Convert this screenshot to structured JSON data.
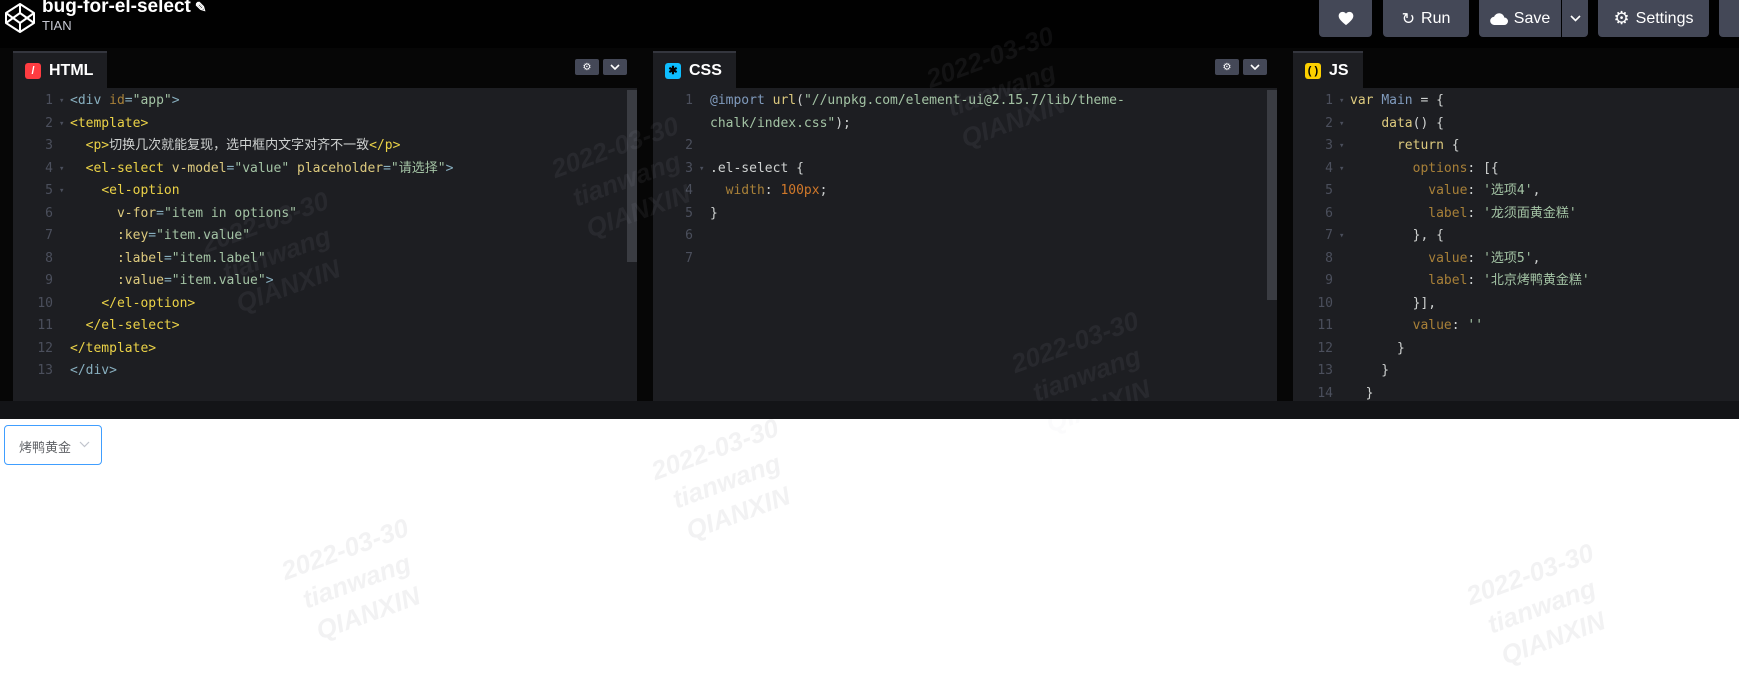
{
  "header": {
    "title": "bug-for-el-select",
    "author": "TIAN",
    "run_label": "Run",
    "save_label": "Save",
    "settings_label": "Settings"
  },
  "panels": {
    "html": {
      "label": "HTML",
      "lines": [
        {
          "n": "1",
          "f": "▾",
          "segs": [
            [
              "tag",
              "<div "
            ],
            [
              "at",
              "id"
            ],
            [
              "tag",
              "="
            ],
            [
              "st",
              "\"app\""
            ],
            [
              "tag",
              ">"
            ]
          ]
        },
        {
          "n": "2",
          "f": "▾",
          "segs": [
            [
              "tg",
              "<template>"
            ]
          ]
        },
        {
          "n": "3",
          "f": "",
          "segs": [
            [
              "plain",
              "  "
            ],
            [
              "tg",
              "<p>"
            ],
            [
              "plain",
              "切换几次就能复现，选中框内文字对齐不一致"
            ],
            [
              "tg",
              "</p>"
            ]
          ]
        },
        {
          "n": "4",
          "f": "▾",
          "segs": [
            [
              "plain",
              "  "
            ],
            [
              "tg",
              "<el-select "
            ],
            [
              "atr",
              "v-model"
            ],
            [
              "tag",
              "="
            ],
            [
              "st",
              "\"value\" "
            ],
            [
              "atr",
              "placeholder"
            ],
            [
              "tag",
              "="
            ],
            [
              "st",
              "\"请选择\""
            ],
            [
              "tag",
              ">"
            ]
          ]
        },
        {
          "n": "5",
          "f": "▾",
          "segs": [
            [
              "plain",
              "    "
            ],
            [
              "tg",
              "<el-option"
            ]
          ]
        },
        {
          "n": "6",
          "f": "",
          "segs": [
            [
              "plain",
              "      "
            ],
            [
              "atr",
              "v-for"
            ],
            [
              "tag",
              "="
            ],
            [
              "st",
              "\"item in options\""
            ]
          ]
        },
        {
          "n": "7",
          "f": "",
          "segs": [
            [
              "plain",
              "      "
            ],
            [
              "atr",
              ":key"
            ],
            [
              "tag",
              "="
            ],
            [
              "st",
              "\"item.value\""
            ]
          ]
        },
        {
          "n": "8",
          "f": "",
          "segs": [
            [
              "plain",
              "      "
            ],
            [
              "atr",
              ":label"
            ],
            [
              "tag",
              "="
            ],
            [
              "st",
              "\"item.label\""
            ]
          ]
        },
        {
          "n": "9",
          "f": "",
          "segs": [
            [
              "plain",
              "      "
            ],
            [
              "atr",
              ":value"
            ],
            [
              "tag",
              "="
            ],
            [
              "st",
              "\"item.value\""
            ],
            [
              "tag",
              ">"
            ]
          ]
        },
        {
          "n": "10",
          "f": "",
          "segs": [
            [
              "plain",
              "    "
            ],
            [
              "tg",
              "</el-option>"
            ]
          ]
        },
        {
          "n": "11",
          "f": "",
          "segs": [
            [
              "plain",
              "  "
            ],
            [
              "tg",
              "</el-select>"
            ]
          ]
        },
        {
          "n": "12",
          "f": "",
          "segs": [
            [
              "tg",
              "</template>"
            ]
          ]
        },
        {
          "n": "13",
          "f": "",
          "segs": [
            [
              "tag",
              "</div>"
            ]
          ]
        }
      ]
    },
    "css": {
      "label": "CSS",
      "lines": [
        {
          "n": "1",
          "f": "",
          "segs": [
            [
              "def",
              "@import "
            ],
            [
              "kw",
              "url"
            ],
            [
              "plain",
              "("
            ],
            [
              "st",
              "\"//unpkg.com/element-ui@2.15.7/lib/theme-"
            ]
          ]
        },
        {
          "n": "",
          "f": "",
          "segs": [
            [
              "st",
              "chalk/index.css\""
            ],
            [
              "plain",
              ");"
            ]
          ]
        },
        {
          "n": "2",
          "f": "",
          "segs": []
        },
        {
          "n": "3",
          "f": "▾",
          "segs": [
            [
              "plain",
              ".el-select {"
            ]
          ]
        },
        {
          "n": "4",
          "f": "",
          "segs": [
            [
              "plain",
              "  "
            ],
            [
              "pr",
              "width"
            ],
            [
              "plain",
              ": "
            ],
            [
              "num",
              "100px"
            ],
            [
              "plain",
              ";"
            ]
          ]
        },
        {
          "n": "5",
          "f": "",
          "segs": [
            [
              "plain",
              "}"
            ]
          ]
        },
        {
          "n": "6",
          "f": "",
          "segs": []
        },
        {
          "n": "7",
          "f": "",
          "segs": []
        }
      ]
    },
    "js": {
      "label": "JS",
      "lines": [
        {
          "n": "1",
          "f": "▾",
          "segs": [
            [
              "kw",
              "var "
            ],
            [
              "def",
              "Main"
            ],
            [
              "plain",
              " = {"
            ]
          ]
        },
        {
          "n": "2",
          "f": "▾",
          "segs": [
            [
              "plain",
              "    "
            ],
            [
              "kw",
              "data"
            ],
            [
              "plain",
              "() {"
            ]
          ]
        },
        {
          "n": "3",
          "f": "▾",
          "segs": [
            [
              "plain",
              "      "
            ],
            [
              "kw",
              "return"
            ],
            [
              "plain",
              " {"
            ]
          ]
        },
        {
          "n": "4",
          "f": "▾",
          "segs": [
            [
              "plain",
              "        "
            ],
            [
              "pr",
              "options"
            ],
            [
              "plain",
              ": [{"
            ]
          ]
        },
        {
          "n": "5",
          "f": "",
          "segs": [
            [
              "plain",
              "          "
            ],
            [
              "pr",
              "value"
            ],
            [
              "plain",
              ": "
            ],
            [
              "st",
              "'选项4'"
            ],
            [
              "plain",
              ","
            ]
          ]
        },
        {
          "n": "6",
          "f": "",
          "segs": [
            [
              "plain",
              "          "
            ],
            [
              "pr",
              "label"
            ],
            [
              "plain",
              ": "
            ],
            [
              "st",
              "'龙须面黄金糕'"
            ]
          ]
        },
        {
          "n": "7",
          "f": "▾",
          "segs": [
            [
              "plain",
              "        }, {"
            ]
          ]
        },
        {
          "n": "8",
          "f": "",
          "segs": [
            [
              "plain",
              "          "
            ],
            [
              "pr",
              "value"
            ],
            [
              "plain",
              ": "
            ],
            [
              "st",
              "'选项5'"
            ],
            [
              "plain",
              ","
            ]
          ]
        },
        {
          "n": "9",
          "f": "",
          "segs": [
            [
              "plain",
              "          "
            ],
            [
              "pr",
              "label"
            ],
            [
              "plain",
              ": "
            ],
            [
              "st",
              "'北京烤鸭黄金糕'"
            ]
          ]
        },
        {
          "n": "10",
          "f": "",
          "segs": [
            [
              "plain",
              "        }],"
            ]
          ]
        },
        {
          "n": "11",
          "f": "",
          "segs": [
            [
              "plain",
              "        "
            ],
            [
              "pr",
              "value"
            ],
            [
              "plain",
              ": "
            ],
            [
              "st",
              "''"
            ]
          ]
        },
        {
          "n": "12",
          "f": "",
          "segs": [
            [
              "plain",
              "      }"
            ]
          ]
        },
        {
          "n": "13",
          "f": "",
          "segs": [
            [
              "plain",
              "    }"
            ]
          ]
        },
        {
          "n": "14",
          "f": "",
          "segs": [
            [
              "plain",
              "  }"
            ]
          ]
        }
      ]
    }
  },
  "result": {
    "select_value": "烤鸭黄金"
  },
  "watermark": {
    "date": "2022-03-30",
    "user": "tianwang",
    "org": "QIANXIN"
  }
}
